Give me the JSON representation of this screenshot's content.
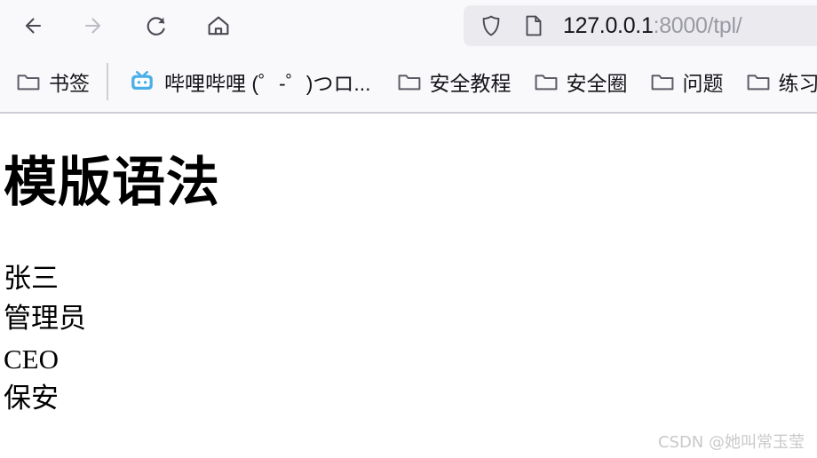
{
  "browser": {
    "nav": {
      "back": {
        "icon": "arrow-left-icon",
        "enabled": true
      },
      "forward": {
        "icon": "arrow-right-icon",
        "enabled": false
      },
      "reload": {
        "icon": "reload-icon",
        "enabled": true
      },
      "home": {
        "icon": "home-icon",
        "enabled": true
      }
    },
    "address_bar": {
      "shield_icon": "shield-icon",
      "page_icon": "document-icon",
      "host": "127.0.0.1",
      "path": ":8000/tpl/",
      "full_url": "127.0.0.1:8000/tpl/"
    },
    "bookmarks": [
      {
        "icon": "folder-icon",
        "label": "书签"
      },
      {
        "icon": "bilibili-icon",
        "label": "哔哩哔哩 (゜-゜)つロ..."
      },
      {
        "icon": "folder-icon",
        "label": "安全教程"
      },
      {
        "icon": "folder-icon",
        "label": "安全圈"
      },
      {
        "icon": "folder-icon",
        "label": "问题"
      },
      {
        "icon": "folder-icon",
        "label": "练习平"
      }
    ]
  },
  "page": {
    "heading": "模版语法",
    "lines": [
      {
        "text": "张三",
        "style": "sans"
      },
      {
        "text": "管理员",
        "style": "sans"
      },
      {
        "text": "CEO",
        "style": "serif"
      },
      {
        "text": "保安",
        "style": "sans"
      }
    ],
    "watermark": "CSDN @她叫常玉莹"
  },
  "colors": {
    "chrome_bg": "#f9f9fb",
    "url_pill_bg": "#ebebef",
    "icon_dark": "#4a4a55",
    "icon_disabled": "#b8b8c0",
    "text_dark": "#15141a",
    "url_path_gray": "#9a9aa4",
    "bilibili_blue": "#4aaee8",
    "watermark_gray": "#c9c9cc",
    "separator": "#cdcdd4"
  }
}
